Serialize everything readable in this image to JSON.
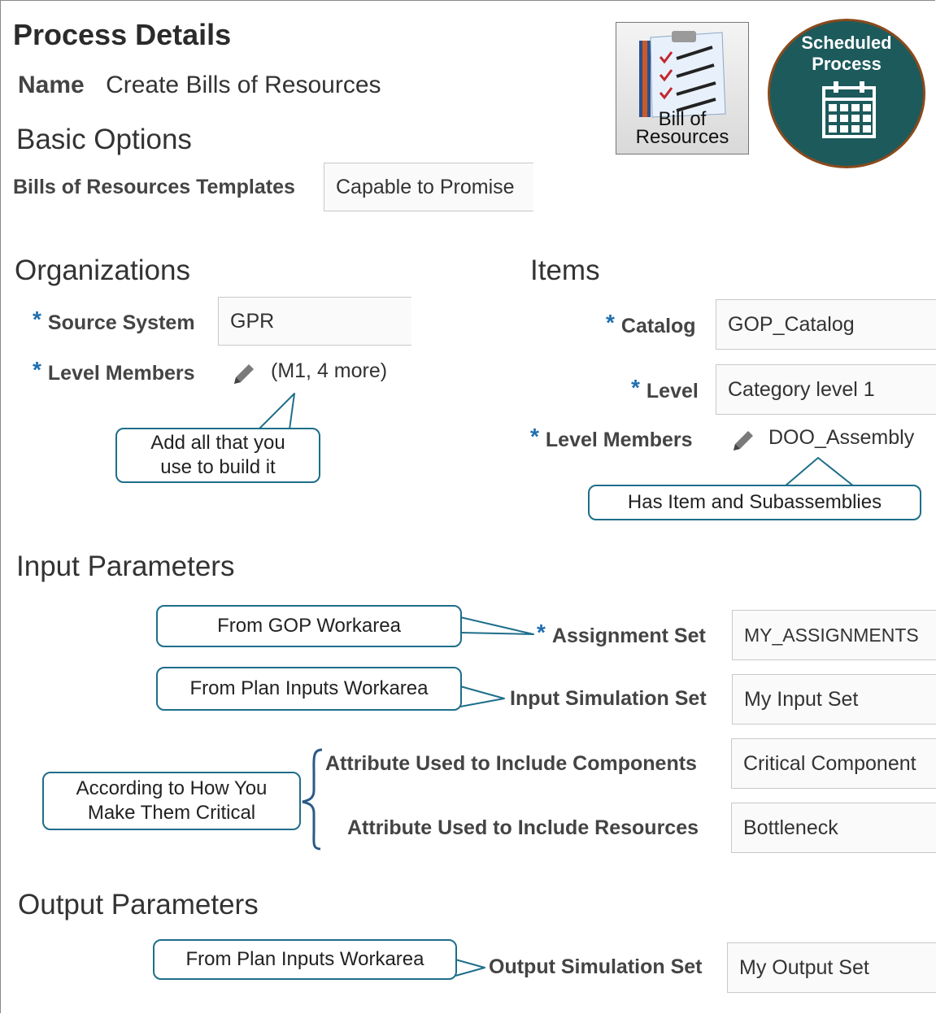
{
  "header": {
    "title": "Process Details",
    "name_label": "Name",
    "name_value": "Create Bills of Resources"
  },
  "basic_options": {
    "heading": "Basic Options",
    "templates_label": "Bills of Resources Templates",
    "templates_value": "Capable to Promise"
  },
  "bor_tile": {
    "label_line1": "Bill of",
    "label_line2": "Resources"
  },
  "scheduled_badge": {
    "line1": "Scheduled",
    "line2": "Process",
    "color": "#1d5a5c",
    "ring": "#8a4a1c"
  },
  "organizations": {
    "heading": "Organizations",
    "source_system_label": "Source System",
    "source_system_value": "GPR",
    "level_members_label": "Level Members",
    "level_members_value": "(M1, 4 more)",
    "callout": {
      "line1": "Add all that you",
      "line2": "use to build it"
    }
  },
  "items": {
    "heading": "Items",
    "catalog_label": "Catalog",
    "catalog_value": "GOP_Catalog",
    "level_label": "Level",
    "level_value": "Category level 1",
    "level_members_label": "Level Members",
    "level_members_value": "DOO_Assembly",
    "callout": "Has Item and Subassemblies"
  },
  "input_parameters": {
    "heading": "Input Parameters",
    "assignment_set_label": "Assignment Set",
    "assignment_set_value": "MY_ASSIGNMENTS",
    "assignment_callout": "From GOP Workarea",
    "input_sim_label": "Input Simulation Set",
    "input_sim_value": "My Input Set",
    "input_sim_callout": "From Plan Inputs Workarea",
    "components_attr_label": "Attribute Used to Include Components",
    "components_attr_value": "Critical Component",
    "resources_attr_label": "Attribute Used to Include Resources",
    "resources_attr_value": "Bottleneck",
    "critical_callout": {
      "line1": "According to How You",
      "line2": "Make Them Critical"
    }
  },
  "output_parameters": {
    "heading": "Output Parameters",
    "output_sim_label": "Output Simulation Set",
    "output_sim_value": "My Output Set",
    "output_sim_callout": "From Plan Inputs Workarea"
  },
  "icons": {
    "required": "required-asterisk-icon",
    "edit": "pencil-icon",
    "checklist": "checklist-icon",
    "calendar": "calendar-icon"
  },
  "colors": {
    "required": "#1f6fb0",
    "callout_border": "#1e6e8a",
    "bracket": "#2a5a86"
  }
}
